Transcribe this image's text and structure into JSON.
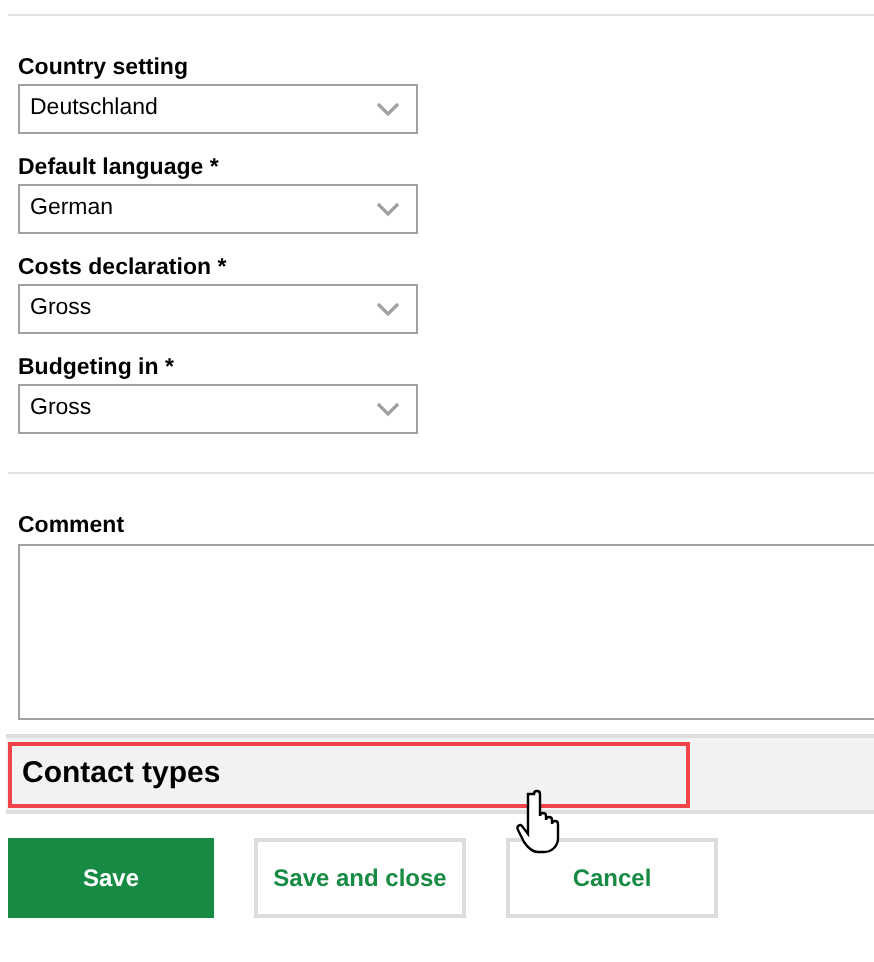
{
  "fields": [
    {
      "label": "Country setting",
      "value": "Deutschland"
    },
    {
      "label": "Default language *",
      "value": "German"
    },
    {
      "label": "Costs declaration *",
      "value": "Gross"
    },
    {
      "label": "Budgeting in *",
      "value": "Gross"
    }
  ],
  "comment": {
    "label": "Comment"
  },
  "section": {
    "title": "Contact types",
    "highlighted": true
  },
  "buttons": [
    {
      "label": "Save",
      "kind": "primary"
    },
    {
      "label": "Save and close",
      "kind": "secondary"
    },
    {
      "label": "Cancel",
      "kind": "secondary"
    }
  ]
}
